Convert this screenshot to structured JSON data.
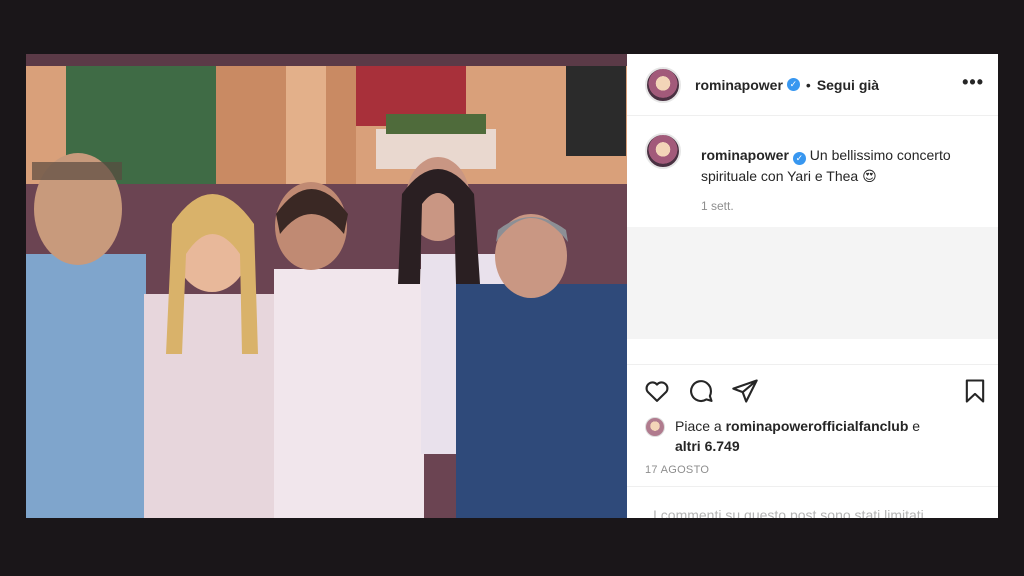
{
  "post": {
    "username": "rominapower",
    "verified_glyph": "✓",
    "separator": "•",
    "follow_status": "Segui già",
    "more_icon": "more-horizontal-icon",
    "more_glyph": "•••",
    "caption": "Un bellissimo concerto spirituale con Yari e Thea",
    "caption_emoji": "😍",
    "time_ago": "1 sett.",
    "likes_prefix": "Piace a",
    "likes_user": "rominapowerofficialfanclub",
    "likes_connector": "e",
    "likes_others": "altri 6.749",
    "date": "17 AGOSTO",
    "comments_notice": "I commenti su questo post sono stati limitati."
  },
  "colors": {
    "text": "#262626",
    "muted": "#8e8e8e",
    "verified": "#3897f0",
    "background": "#1a1619"
  },
  "icons": [
    "heart-icon",
    "comment-icon",
    "share-icon",
    "bookmark-icon"
  ]
}
